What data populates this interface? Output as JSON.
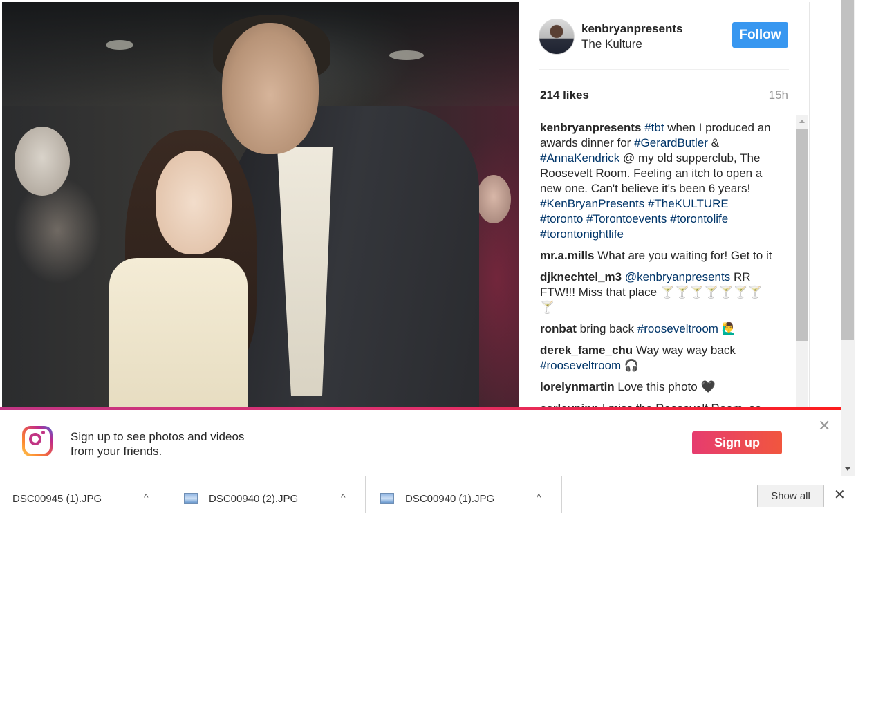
{
  "post": {
    "username": "kenbryanpresents",
    "location": "The Kulture",
    "follow_label": "Follow",
    "likes": "214 likes",
    "time": "15h"
  },
  "comments": [
    {
      "user": "kenbryanpresents",
      "segments": [
        {
          "t": "tag",
          "v": "#tbt"
        },
        {
          "t": "text",
          "v": " when I produced an awards dinner for "
        },
        {
          "t": "tag",
          "v": "#GerardButler"
        },
        {
          "t": "text",
          "v": " & "
        },
        {
          "t": "tag",
          "v": "#AnnaKendrick"
        },
        {
          "t": "text",
          "v": " @ my old supperclub, The Roosevelt Room. Feeling an itch to open a new one. Can't believe it's been 6 years! "
        },
        {
          "t": "tag",
          "v": "#KenBryanPresents"
        },
        {
          "t": "text",
          "v": " "
        },
        {
          "t": "tag",
          "v": "#TheKULTURE"
        },
        {
          "t": "text",
          "v": " "
        },
        {
          "t": "tag",
          "v": "#toronto"
        },
        {
          "t": "text",
          "v": " "
        },
        {
          "t": "tag",
          "v": "#Torontoevents"
        },
        {
          "t": "text",
          "v": " "
        },
        {
          "t": "tag",
          "v": "#torontolife"
        },
        {
          "t": "text",
          "v": " "
        },
        {
          "t": "tag",
          "v": "#torontonightlife"
        }
      ]
    },
    {
      "user": "mr.a.mills",
      "segments": [
        {
          "t": "text",
          "v": " What are you waiting for! Get to it"
        }
      ]
    },
    {
      "user": "djknechtel_m3",
      "segments": [
        {
          "t": "text",
          "v": " "
        },
        {
          "t": "tag",
          "v": "@kenbryanpresents"
        },
        {
          "t": "text",
          "v": " RR FTW!!! Miss that place 🍸🍸🍸🍸🍸🍸🍸🍸"
        }
      ]
    },
    {
      "user": "ronbat",
      "segments": [
        {
          "t": "text",
          "v": " bring back "
        },
        {
          "t": "tag",
          "v": "#rooseveltroom"
        },
        {
          "t": "text",
          "v": " 🙋‍♂️"
        }
      ]
    },
    {
      "user": "derek_fame_chu",
      "segments": [
        {
          "t": "text",
          "v": " Way way way back "
        },
        {
          "t": "tag",
          "v": "#rooseveltroom"
        },
        {
          "t": "text",
          "v": " 🎧"
        }
      ]
    },
    {
      "user": "lorelynmartin",
      "segments": [
        {
          "t": "text",
          "v": " Love this photo 🖤"
        }
      ]
    },
    {
      "user": "carleypinn",
      "segments": [
        {
          "t": "text",
          "v": " I miss the Roosevelt Room, so"
        }
      ]
    }
  ],
  "banner": {
    "line1": "Sign up to see photos and videos",
    "line2": "from your friends.",
    "signup_label": "Sign up",
    "close_glyph": "✕"
  },
  "downloads": {
    "items": [
      {
        "name": "DSC00945 (1).JPG",
        "chevron": "^"
      },
      {
        "name": "DSC00940 (2).JPG",
        "chevron": "^"
      },
      {
        "name": "DSC00940 (1).JPG",
        "chevron": "^"
      }
    ],
    "show_all_label": "Show all",
    "close_glyph": "✕"
  },
  "colors": {
    "follow_blue": "#3897f0",
    "hashtag": "#003569",
    "signup_gradient_start": "#e63c6f",
    "signup_gradient_end": "#f1563e"
  },
  "icons": [
    "instagram-logo-icon",
    "image-file-icon",
    "chevron-up-icon",
    "close-icon"
  ]
}
